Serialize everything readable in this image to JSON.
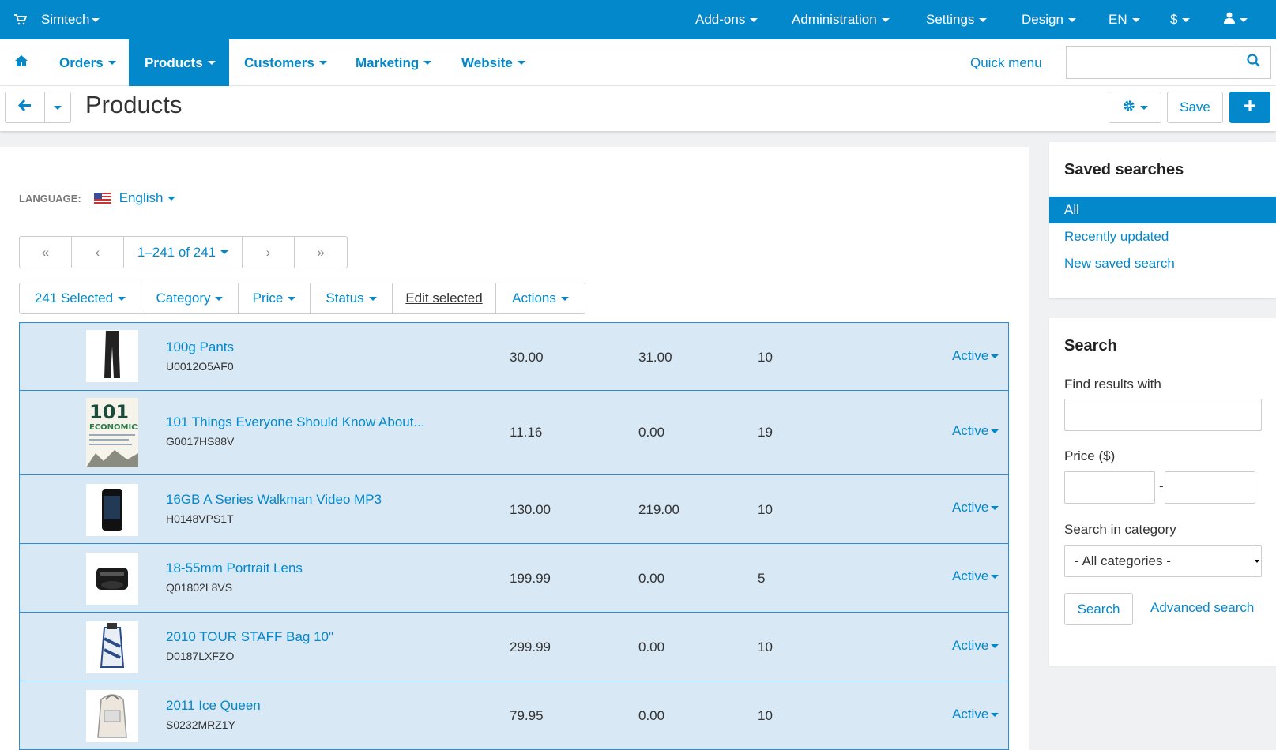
{
  "topbar": {
    "brand": "Simtech",
    "menu": [
      "Add-ons",
      "Administration",
      "Settings",
      "Design",
      "EN",
      "$"
    ]
  },
  "nav": {
    "items": [
      "Orders",
      "Products",
      "Customers",
      "Marketing",
      "Website"
    ],
    "active": "Products",
    "quick_menu": "Quick menu",
    "search_placeholder": ""
  },
  "titlebar": {
    "title": "Products",
    "save_label": "Save"
  },
  "language": {
    "label": "LANGUAGE:",
    "value": "English"
  },
  "pager": {
    "first": "«",
    "prev": "‹",
    "range": "1–241 of 241",
    "next": "›",
    "last": "»"
  },
  "toolbar": {
    "selected": "241 Selected",
    "category": "Category",
    "price": "Price",
    "status": "Status",
    "edit_selected": "Edit selected",
    "actions": "Actions"
  },
  "products": [
    {
      "name": "100g Pants",
      "code": "U0012O5AF0",
      "price": "30.00",
      "list_price": "31.00",
      "qty": "10",
      "status": "Active"
    },
    {
      "name": "101 Things Everyone Should Know About...",
      "code": "G0017HS88V",
      "price": "11.16",
      "list_price": "0.00",
      "qty": "19",
      "status": "Active"
    },
    {
      "name": "16GB A Series Walkman Video MP3",
      "code": "H0148VPS1T",
      "price": "130.00",
      "list_price": "219.00",
      "qty": "10",
      "status": "Active"
    },
    {
      "name": "18-55mm Portrait Lens",
      "code": "Q01802L8VS",
      "price": "199.99",
      "list_price": "0.00",
      "qty": "5",
      "status": "Active"
    },
    {
      "name": "2010 TOUR STAFF Bag 10\"",
      "code": "D0187LXFZO",
      "price": "299.99",
      "list_price": "0.00",
      "qty": "10",
      "status": "Active"
    },
    {
      "name": "2011 Ice Queen",
      "code": "S0232MRZ1Y",
      "price": "79.95",
      "list_price": "0.00",
      "qty": "10",
      "status": "Active"
    }
  ],
  "book_cover": {
    "line1": "101",
    "line2": "ECONOMICS"
  },
  "saved_searches": {
    "title": "Saved searches",
    "items": [
      "All",
      "Recently updated",
      "New saved search"
    ],
    "selected": "All"
  },
  "search": {
    "title": "Search",
    "find_label": "Find results with",
    "find_value": "",
    "price_label": "Price ($)",
    "price_sep": "-",
    "category_label": "Search in category",
    "category_value": "- All categories -",
    "search_button": "Search",
    "advanced": "Advanced search"
  },
  "colors": {
    "accent": "#0388cc",
    "row_bg": "#d9e8f5",
    "row_border": "#2d8bd4"
  },
  "icons": {
    "cart": "cart-icon",
    "home": "home-icon",
    "search": "search-icon",
    "back": "arrow-left-icon",
    "gear": "gear-icon",
    "plus": "plus-icon",
    "user": "user-icon"
  }
}
